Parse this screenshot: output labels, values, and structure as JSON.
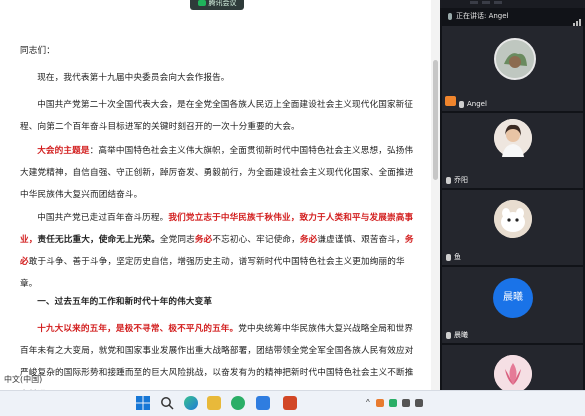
{
  "meeting": {
    "badge": "腾讯会议",
    "speaking_label": "正在讲话: Angel",
    "participants": [
      {
        "name": "Angel",
        "host": true
      },
      {
        "name": "乔阳"
      },
      {
        "name": "鱼"
      },
      {
        "name": "晨曦",
        "avatar_text": "晨曦",
        "avatar_color": "#1a73e8"
      },
      {
        "name": "陈曦"
      }
    ]
  },
  "document": {
    "greeting": "同志们：",
    "p1": "现在，我代表第十九届中央委员会向大会作报告。",
    "p2": "中国共产党第二十次全国代表大会，是在全党全国各族人民迈上全面建设社会主义现代化国家新征程、向第二个百年奋斗目标进军的关键时刻召开的一次十分重要的大会。",
    "p3_red": "大会的主题是",
    "p3_rest": "：高举中国特色社会主义伟大旗帜，全面贯彻新时代中国特色社会主义思想，弘扬伟大建党精神，自信自强、守正创新，踔厉奋发、勇毅前行，为全面建设社会主义现代化国家、全面推进中华民族伟大复兴而团结奋斗。",
    "p4_a": "中国共产党已走过百年奋斗历程。",
    "p4_red1": "我们党立志于中华民族千秋伟业，致力于人类和平与发展崇高事业，",
    "p4_bold": "责任无比重大，使命无上光荣。",
    "p4_b": "全党同志",
    "p4_red2": "务必",
    "p4_c": "不忘初心、牢记使命，",
    "p4_red3": "务必",
    "p4_d": "谦虚谨慎、艰苦奋斗，",
    "p4_red4": "务必",
    "p4_e": "敢于斗争、善于斗争，坚定历史自信，增强历史主动，谱写新时代中国特色社会主义更加绚丽的华章。",
    "heading": "一、过去五年的工作和新时代十年的伟大变革",
    "p5_red": "十九大以来的五年，是极不寻常、极不平凡的五年。",
    "p5_rest": "党中央统筹中华民族伟大复兴战略全局和世界百年未有之大变局，就党和国家事业发展作出重大战略部署，团结带领全党全军全国各族人民有效应对严峻复杂的国际形势和接踵而至的巨大风险挑战，以奋发有为的精神把新时代中国特色社会主义不断推向前进。",
    "status_left": "中文(中国)"
  },
  "colors": {
    "red_emphasis": "#d21d1d",
    "panel_bg": "#111318",
    "taskbar_bg": "#eef2f8"
  },
  "taskbar": {
    "icons": [
      "windows-start-icon",
      "search-icon",
      "file-explorer-icon",
      "edge-icon",
      "folder-icon",
      "wechat-icon",
      "tencent-meeting-icon",
      "photos-icon",
      "powerpoint-icon"
    ],
    "tray_text": "^"
  }
}
